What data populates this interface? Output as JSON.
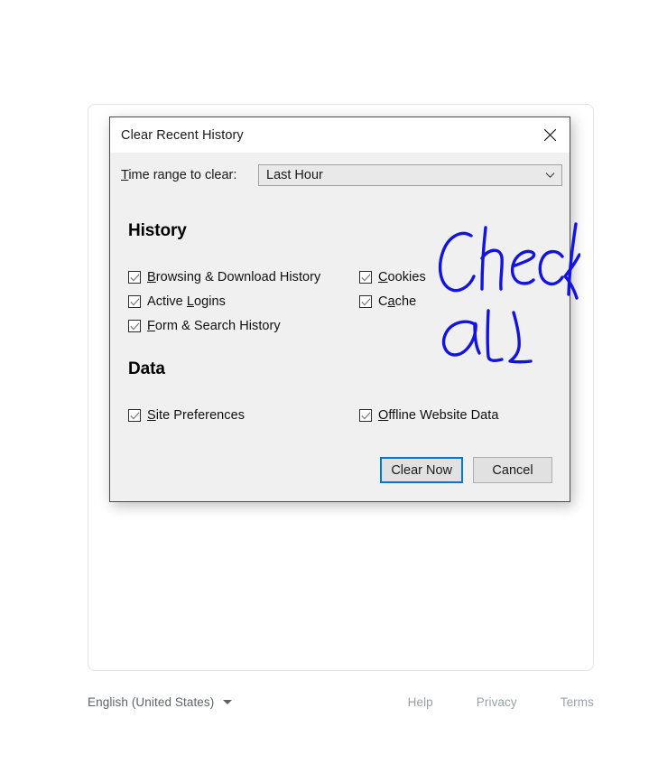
{
  "dialog": {
    "title": "Clear Recent History",
    "close_icon": "close-icon",
    "time_range": {
      "label": "Time range to clear:",
      "label_accesskey": "T",
      "selected_value": "Last Hour",
      "chevron_icon": "chevron-down-icon"
    },
    "sections": [
      {
        "heading": "History",
        "columns": [
          {
            "items": [
              {
                "label": "Browsing & Download History",
                "accesskey": "B",
                "checked": true
              },
              {
                "label": "Active Logins",
                "accesskey": "L",
                "checked": true
              },
              {
                "label": "Form & Search History",
                "accesskey": "F",
                "checked": true
              }
            ]
          },
          {
            "items": [
              {
                "label": "Cookies",
                "accesskey": "C",
                "checked": true
              },
              {
                "label": "Cache",
                "accesskey": "a",
                "checked": true
              }
            ]
          }
        ]
      },
      {
        "heading": "Data",
        "columns": [
          {
            "items": [
              {
                "label": "Site Preferences",
                "accesskey": "S",
                "checked": true
              }
            ]
          },
          {
            "items": [
              {
                "label": "Offline Website Data",
                "accesskey": "O",
                "checked": true
              }
            ]
          }
        ]
      }
    ],
    "buttons": {
      "primary_label": "Clear Now",
      "cancel_label": "Cancel",
      "focus_color": "#0078d7"
    }
  },
  "annotation": {
    "text": "Check all",
    "color": "#1414e0"
  },
  "footer": {
    "language": "English (United States)",
    "language_caret_icon": "caret-down-icon",
    "links": [
      {
        "label": "Help"
      },
      {
        "label": "Privacy"
      },
      {
        "label": "Terms"
      }
    ]
  }
}
